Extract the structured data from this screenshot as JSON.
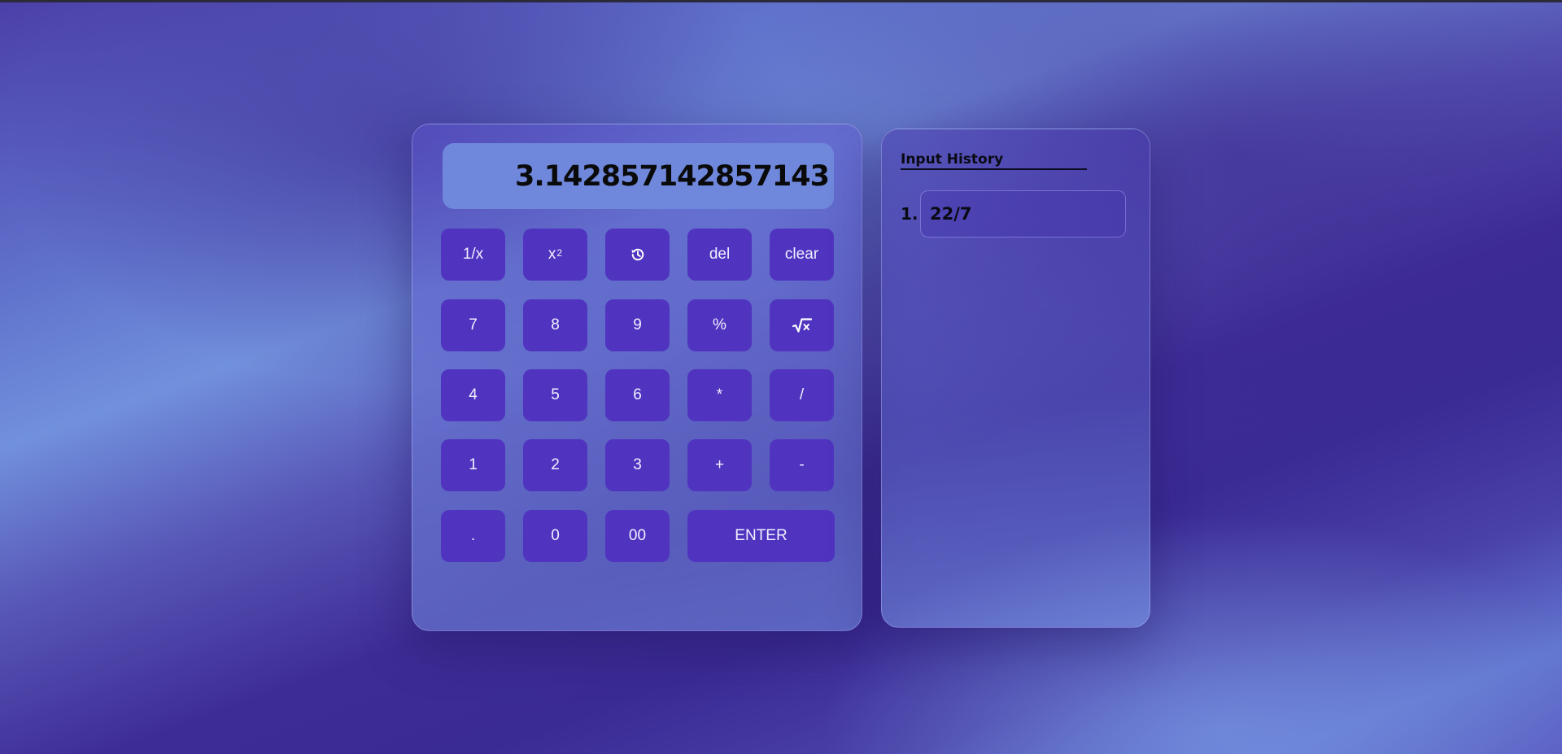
{
  "display": {
    "value": "3.142857142857143"
  },
  "keys": {
    "reciprocal": "1/x",
    "square_base": "x",
    "square_exp": "2",
    "history_icon": "history-icon",
    "del": "del",
    "clear": "clear",
    "seven": "7",
    "eight": "8",
    "nine": "9",
    "percent": "%",
    "sqrt_icon": "square-root-icon",
    "four": "4",
    "five": "5",
    "six": "6",
    "multiply": "*",
    "divide": "/",
    "one": "1",
    "two": "2",
    "three": "3",
    "plus": "+",
    "minus": "-",
    "dot": ".",
    "zero": "0",
    "double_zero": "00",
    "enter": "ENTER"
  },
  "history": {
    "title": "Input History",
    "items": [
      {
        "index": "1.",
        "expression": "22/7"
      }
    ]
  },
  "colors": {
    "key_bg": "#5034c0",
    "display_bg": "#7088dc",
    "key_text": "#f1f0ff"
  }
}
